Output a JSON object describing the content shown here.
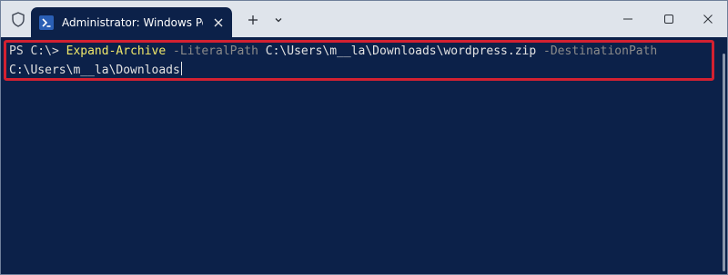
{
  "window": {
    "tab_title": "Administrator: Windows PowerShell",
    "icons": {
      "app": "shield-icon",
      "tab": "powershell-icon",
      "tab_close": "close-icon",
      "new_tab": "plus-icon",
      "dropdown": "chevron-down-icon",
      "minimize": "minimize-icon",
      "maximize": "maximize-icon",
      "close": "close-icon"
    }
  },
  "terminal": {
    "prompt": "PS C:\\> ",
    "command": "Expand-Archive",
    "param1": "-LiteralPath",
    "arg1": "C:\\Users\\m__la\\Downloads\\wordpress.zip",
    "param2": "-DestinationPath",
    "arg2": "C:\\Users\\m__la\\Downloads"
  },
  "colors": {
    "terminal_background": "#0c2149",
    "titlebar_background": "#dfe4eb",
    "command": "#f0e86a",
    "parameter": "#8a8a8a",
    "highlight_border": "#d32131"
  }
}
